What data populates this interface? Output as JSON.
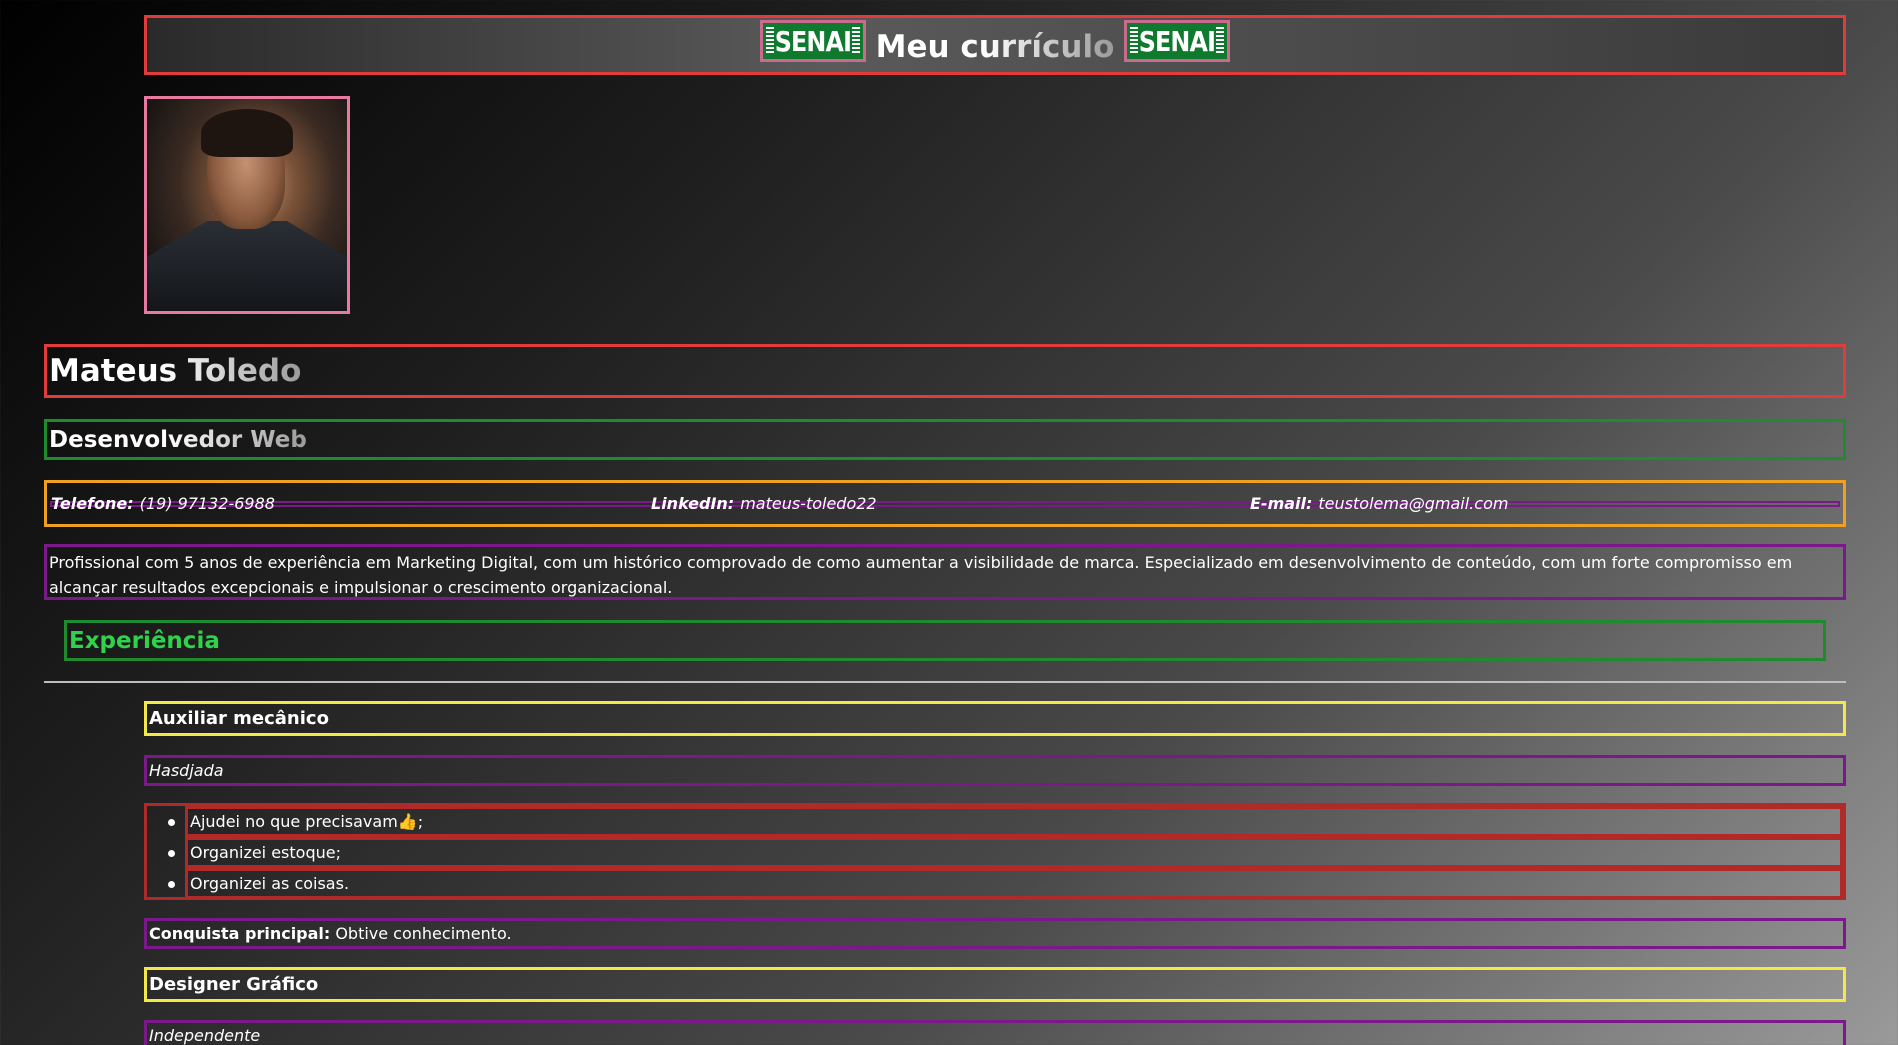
{
  "header": {
    "logo_text": "SENAI",
    "title": "Meu currículo"
  },
  "profile": {
    "photo_alt": "profile-photo",
    "name": "Mateus Toledo",
    "role": "Desenvolvedor Web"
  },
  "contact": {
    "phone_label": "Telefone:",
    "phone_value": "(19) 97132-6988",
    "linkedin_label": "LinkedIn:",
    "linkedin_value": "mateus-toledo22",
    "email_label": "E-mail:",
    "email_value": "teustolema@gmail.com"
  },
  "summary": "Profissional com 5 anos de experiência em Marketing Digital, com um histórico comprovado de como aumentar a visibilidade de marca. Especializado em desenvolvimento de conteúdo, com um forte compromisso em alcançar resultados excepcionais e impulsionar o crescimento organizacional.",
  "experience": {
    "section_title": "Experiência",
    "jobs": [
      {
        "title": "Auxiliar mecânico",
        "company": "Hasdjada",
        "tasks": [
          "Ajudei no que precisavam👍;",
          "Organizei estoque;",
          "Organizei as coisas."
        ],
        "achievement_label": "Conquista principal:",
        "achievement_value": "Obtive conhecimento."
      },
      {
        "title": "Designer Gráfico",
        "company": "Independente"
      }
    ]
  },
  "colors": {
    "header_border": "#e23b3b",
    "role_border": "#1f8a2e",
    "contact_border": "#f0a020",
    "purple_border": "#7a1a8a",
    "job_title_border": "#f2e84a",
    "tasks_border": "#b02a2a",
    "experience_title": "#2fd24a",
    "senai_green": "#0f7a2e"
  }
}
